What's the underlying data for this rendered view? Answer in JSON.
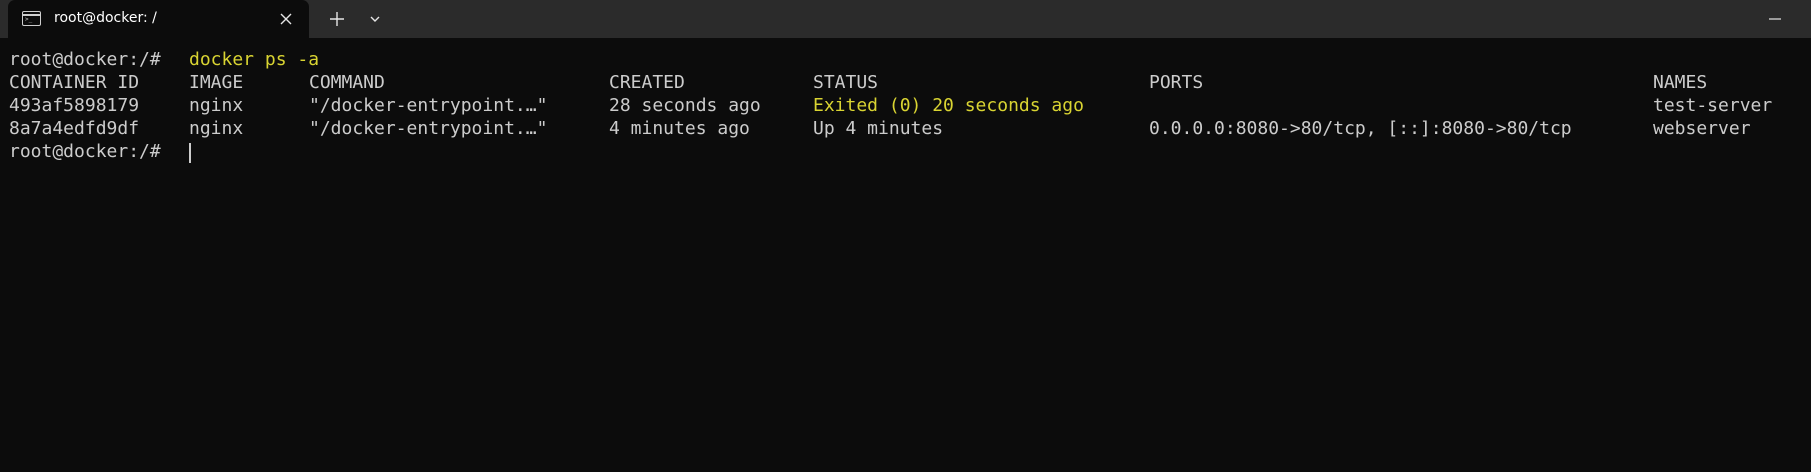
{
  "window": {
    "tab_title": "root@docker: /",
    "tab_icon": "terminal-icon",
    "controls": {
      "close_icon": "close-icon",
      "new_tab_icon": "plus-icon",
      "dropdown_icon": "chevron-down-icon",
      "minimize_icon": "minimize-icon"
    }
  },
  "terminal": {
    "prompt": "root@docker:/# ",
    "command": "docker ps -a",
    "colors": {
      "background": "#0c0c0c",
      "foreground": "#cccccc",
      "highlight": "#d9d432"
    },
    "table": {
      "headers": [
        "CONTAINER ID",
        "IMAGE",
        "COMMAND",
        "CREATED",
        "STATUS",
        "PORTS",
        "NAMES"
      ],
      "rows": [
        [
          "493af5898179",
          "nginx",
          "\"/docker-entrypoint.…\"",
          "28 seconds ago",
          "Exited (0) 20 seconds ago",
          "",
          "test-server"
        ],
        [
          "8a7a4edfd9df",
          "nginx",
          "\"/docker-entrypoint.…\"",
          "4 minutes ago",
          "Up 4 minutes",
          "0.0.0.0:8080->80/tcp, [::]:8080->80/tcp",
          "webserver"
        ]
      ]
    },
    "final_prompt": "root@docker:/# "
  }
}
